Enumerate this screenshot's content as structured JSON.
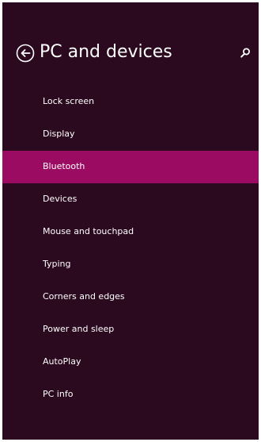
{
  "header": {
    "title": "PC and devices",
    "back_icon": "back-arrow-circle-icon",
    "search_icon": "search-icon"
  },
  "colors": {
    "background": "#2b0a1f",
    "selected": "#9a0b61",
    "text": "#ffffff"
  },
  "nav": {
    "selected_index": 2,
    "items": [
      {
        "label": "Lock screen"
      },
      {
        "label": "Display"
      },
      {
        "label": "Bluetooth"
      },
      {
        "label": "Devices"
      },
      {
        "label": "Mouse and touchpad"
      },
      {
        "label": "Typing"
      },
      {
        "label": "Corners and edges"
      },
      {
        "label": "Power and sleep"
      },
      {
        "label": "AutoPlay"
      },
      {
        "label": "PC info"
      }
    ]
  }
}
